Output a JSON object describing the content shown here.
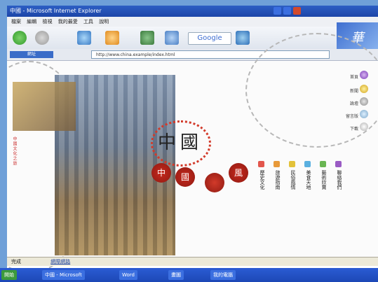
{
  "window": {
    "title": "中國 - Microsoft Internet Explorer"
  },
  "menu": [
    "檔案",
    "編輯",
    "檢視",
    "我的最愛",
    "工具",
    "說明"
  ],
  "toolbar": {
    "search_engine": "Google",
    "address_label": "網址"
  },
  "address": {
    "url": "http://www.china.example/index.html"
  },
  "logo": {
    "char1": "中",
    "char2": "國",
    "seals": [
      "中",
      "國",
      "風"
    ]
  },
  "nav_columns": [
    {
      "color": "#e2564c",
      "text": "歷史文化"
    },
    {
      "color": "#e89a3a",
      "text": "旅遊指南"
    },
    {
      "color": "#e3c23a",
      "text": "民俗風情"
    },
    {
      "color": "#5ab0e0",
      "text": "美食天地"
    },
    {
      "color": "#69b552",
      "text": "藝術欣賞"
    },
    {
      "color": "#9a5bc4",
      "text": "聯絡我們"
    }
  ],
  "side_links": [
    "首頁",
    "新聞",
    "論壇",
    "留言版",
    "下載"
  ],
  "left_vertical": "中國文化之旅",
  "status": {
    "text": "完成",
    "link": "網際網路"
  },
  "taskbar": [
    "開始",
    "中國 - Microsoft",
    "Word",
    "畫圖",
    "我的電腦"
  ]
}
